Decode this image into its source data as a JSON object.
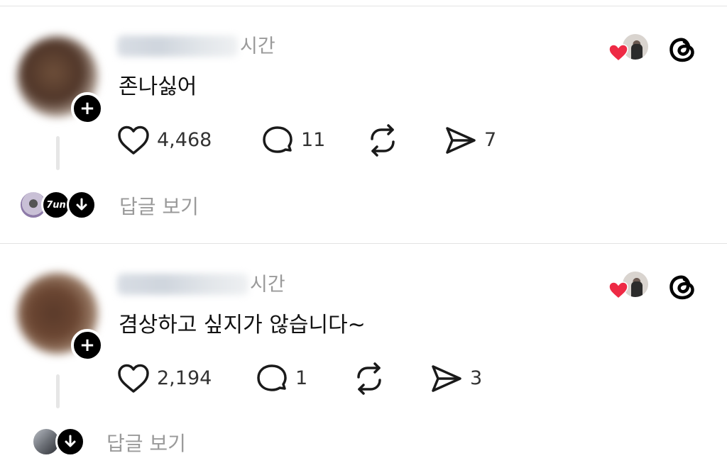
{
  "posts": [
    {
      "time": "시간",
      "text": "존나싫어",
      "likes": "4,468",
      "comments": "11",
      "shares": "7",
      "replies_label": "답글 보기",
      "reply_avatar_text": "7un"
    },
    {
      "time": "시간",
      "text": "겸상하고 싶지가 않습니다~",
      "likes": "2,194",
      "comments": "1",
      "shares": "3",
      "replies_label": "답글 보기"
    }
  ],
  "icons": {
    "like": "heart-outline-icon",
    "comment": "speech-bubble-icon",
    "repost": "repost-arrows-icon",
    "share": "paper-plane-icon",
    "follow": "plus-icon",
    "logo": "threads-logo-icon",
    "liked": "heart-filled-icon"
  },
  "colors": {
    "heart": "#ee2a45",
    "text": "#111111",
    "muted": "#9a9a9a"
  }
}
